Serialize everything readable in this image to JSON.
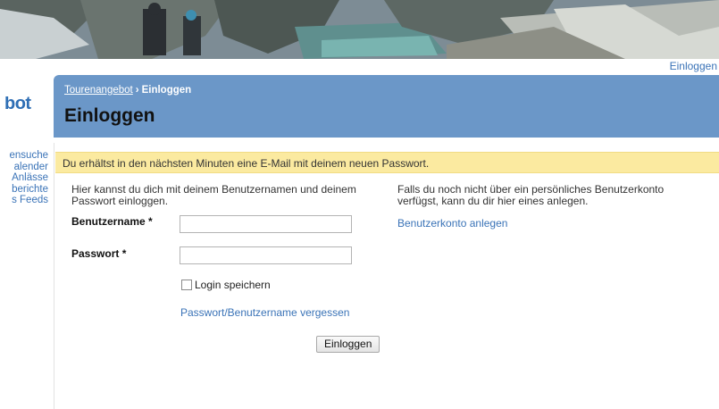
{
  "topbar": {
    "login_link": "Einloggen"
  },
  "logo": {
    "text": "bot"
  },
  "sidebar": {
    "items": [
      {
        "label": "ensuche"
      },
      {
        "label": "alender"
      },
      {
        "label": "Anlässe"
      },
      {
        "label": "berichte"
      },
      {
        "label": "s Feeds"
      }
    ]
  },
  "header": {
    "breadcrumb_parent": "Tourenangebot",
    "breadcrumb_separator": "›",
    "breadcrumb_current": "Einloggen",
    "title": "Einloggen"
  },
  "notice": {
    "text": "Du erhältst in den nächsten Minuten eine E-Mail mit deinem neuen Passwort."
  },
  "login_form": {
    "intro": "Hier kannst du dich mit deinem Benutzernamen und deinem Passwort einloggen.",
    "username_label": "Benutzername *",
    "username_value": "",
    "password_label": "Passwort *",
    "password_value": "",
    "remember_label": "Login speichern",
    "remember_checked": false,
    "forgot_link": "Passwort/Benutzername vergessen",
    "submit_label": "Einloggen"
  },
  "register": {
    "info": "Falls du noch nicht über ein persönliches Benutzerkonto verfügst, kann du dir hier eines anlegen.",
    "link": "Benutzerkonto anlegen"
  },
  "colors": {
    "header_bg": "#6b97c8",
    "notice_bg": "#fbeaa0",
    "link": "#3a73b7"
  }
}
